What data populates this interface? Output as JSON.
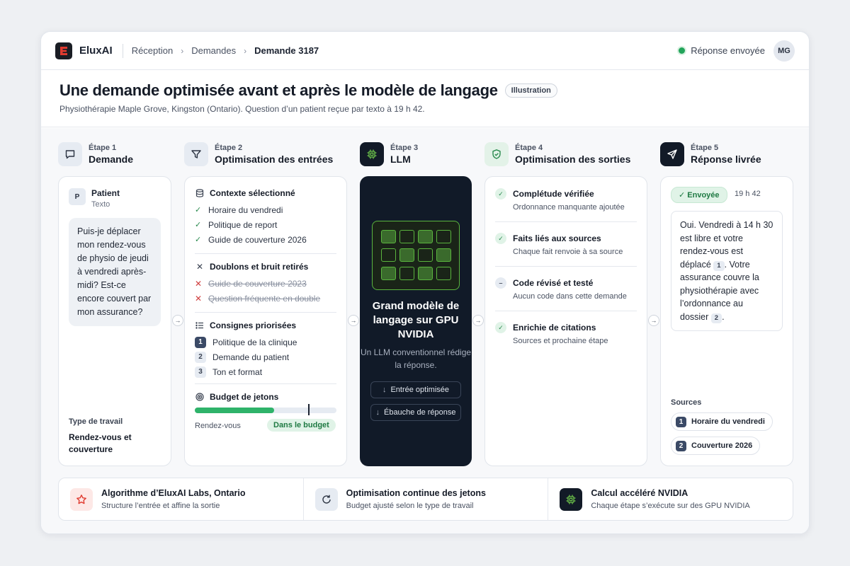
{
  "topbar": {
    "brand": "EluxAI",
    "breadcrumbs": [
      "Réception",
      "Demandes",
      "Demande 3187"
    ],
    "status": "Réponse envoyée",
    "avatar": "MG"
  },
  "header": {
    "title": "Une demande optimisée avant et après le modèle de langage",
    "tag": "Illustration",
    "subtitle": "Physiothérapie Maple Grove, Kingston (Ontario). Question d’un patient reçue par texto à 19 h 42."
  },
  "steps": [
    {
      "num": "Étape 1",
      "name": "Demande"
    },
    {
      "num": "Étape 2",
      "name": "Optimisation des entrées"
    },
    {
      "num": "Étape 3",
      "name": "LLM"
    },
    {
      "num": "Étape 4",
      "name": "Optimisation des sorties"
    },
    {
      "num": "Étape 5",
      "name": "Réponse livrée"
    }
  ],
  "request": {
    "initial": "P",
    "sender": "Patient",
    "channel": "Texto",
    "message": "Puis-je déplacer mon rendez-vous de physio de jeudi à vendredi après-midi? Est-ce encore couvert par mon assurance?",
    "worktype_label": "Type de travail",
    "worktype": "Rendez-vous et couverture"
  },
  "input_opt": {
    "context_title": "Contexte sélectionné",
    "context_items": [
      "Horaire du vendredi",
      "Politique de report",
      "Guide de couverture 2026"
    ],
    "removed_title": "Doublons et bruit retirés",
    "removed_items": [
      "Guide de couverture 2023",
      "Question fréquente en double"
    ],
    "priority_title": "Consignes priorisées",
    "priority_items": [
      "Politique de la clinique",
      "Demande du patient",
      "Ton et format"
    ],
    "budget_title": "Budget de jetons",
    "budget_fill": 0.56,
    "budget_limit": 0.8,
    "budget_label": "Rendez-vous",
    "budget_status": "Dans le budget"
  },
  "llm": {
    "title": "Grand modèle de langage sur GPU NVIDIA",
    "subtitle": "Un LLM conventionnel rédige la réponse.",
    "btn_in": "Entrée optimisée",
    "btn_out": "Ébauche de réponse"
  },
  "output_opt": [
    {
      "title": "Complétude vérifiée",
      "sub": "Ordonnance manquante ajoutée"
    },
    {
      "title": "Faits liés aux sources",
      "sub": "Chaque fait renvoie à sa source"
    },
    {
      "title": "Code révisé et testé",
      "sub": "Aucun code dans cette demande"
    },
    {
      "title": "Enrichie de citations",
      "sub": "Sources et prochaine étape"
    }
  ],
  "delivery": {
    "badge": "Envoyée",
    "time": "19 h 42",
    "answer_1": "Oui. Vendredi à 14 h 30 est libre et votre rendez-vous est déplacé",
    "cite_1": "1",
    "answer_2": ". Votre assurance couvre la physiothérapie avec l’ordonnance au dossier",
    "cite_2": "2",
    "answer_3": ".",
    "sources_label": "Sources",
    "sources": [
      {
        "n": "1",
        "label": "Horaire du vendredi"
      },
      {
        "n": "2",
        "label": "Couverture 2026"
      }
    ]
  },
  "footer": [
    {
      "title": "Algorithme d’EluxAI Labs, Ontario",
      "sub": "Structure l’entrée et affine la sortie"
    },
    {
      "title": "Optimisation continue des jetons",
      "sub": "Budget ajusté selon le type de travail"
    },
    {
      "title": "Calcul accéléré NVIDIA",
      "sub": "Chaque étape s’exécute sur des GPU NVIDIA"
    }
  ],
  "colors": {
    "accent_red": "#e03a2f",
    "success": "#22a45a",
    "nvidia_green": "#5ab43e",
    "dark": "#111a28"
  }
}
